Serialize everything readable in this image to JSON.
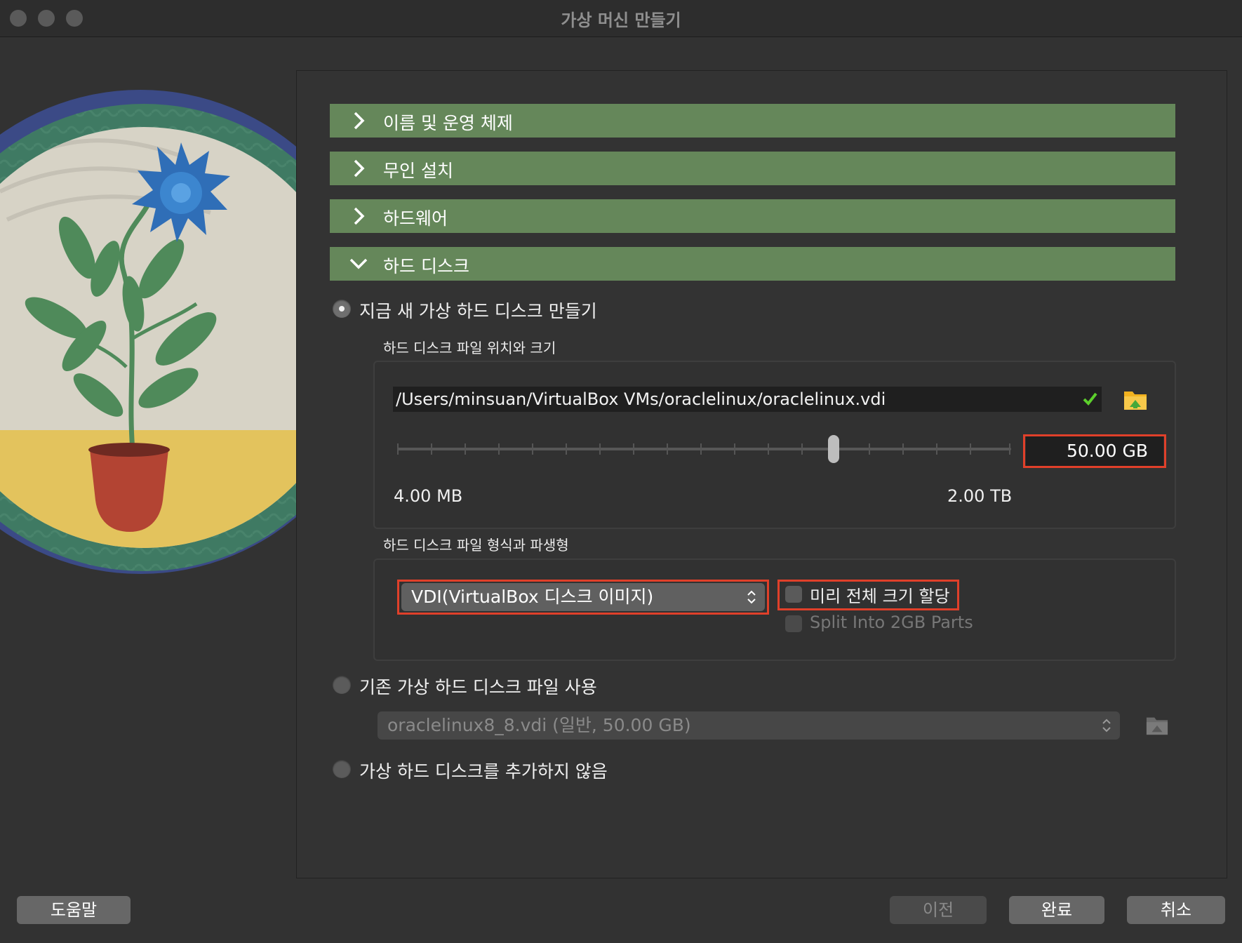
{
  "window": {
    "title": "가상 머신 만들기"
  },
  "sections": [
    {
      "label": "이름 및 운영 체제",
      "expanded": false
    },
    {
      "label": "무인 설치",
      "expanded": false
    },
    {
      "label": "하드웨어",
      "expanded": false
    },
    {
      "label": "하드 디스크",
      "expanded": true
    }
  ],
  "hard_disk": {
    "option_new": "지금 새 가상 하드 디스크 만들기",
    "location_group_label": "하드 디스크 파일 위치와 크기",
    "file_path": "/Users/minsuan/VirtualBox VMs/oraclelinux/oraclelinux.vdi",
    "size_value": "50.00 GB",
    "size_min_label": "4.00 MB",
    "size_max_label": "2.00 TB",
    "format_group_label": "하드 디스크 파일 형식과 파생형",
    "format_selected": "VDI(VirtualBox 디스크 이미지)",
    "preallocate_label": "미리 전체 크기 할당",
    "preallocate_checked": false,
    "split_label": "Split Into 2GB Parts",
    "split_checked": false,
    "option_existing": "기존 가상 하드 디스크 파일 사용",
    "existing_selected": "oraclelinux8_8.vdi (일반, 50.00 GB)",
    "option_none": "가상 하드 디스크를 추가하지 않음",
    "selected_option": "new"
  },
  "buttons": {
    "help": "도움말",
    "back": "이전",
    "finish": "완료",
    "cancel": "취소"
  },
  "colors": {
    "section_header": "#65875a",
    "highlight_box": "#e0402a",
    "check_ok": "#5ccf2c",
    "folder": "#f2b21f"
  }
}
